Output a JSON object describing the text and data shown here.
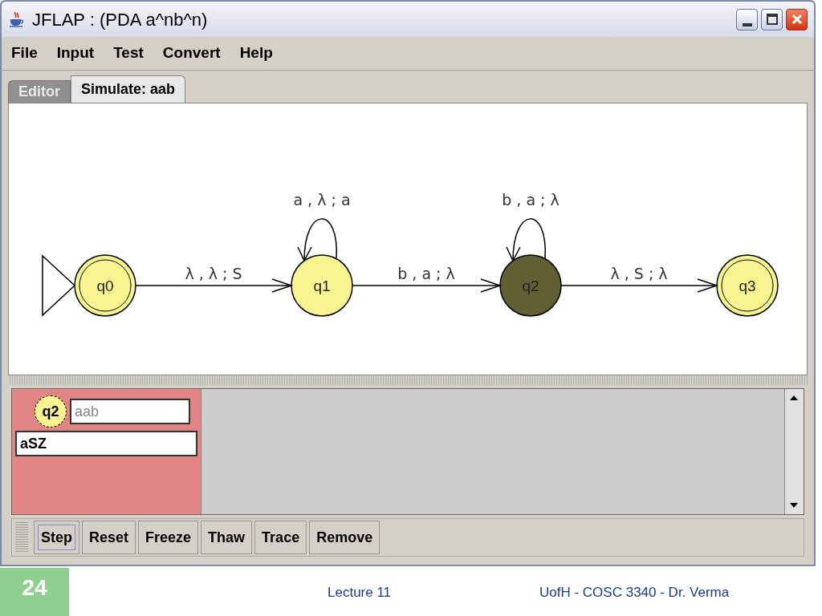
{
  "window": {
    "title": "JFLAP : (PDA a^nb^n)"
  },
  "menu": [
    "File",
    "Input",
    "Test",
    "Convert",
    "Help"
  ],
  "tabs": [
    {
      "label": "Editor",
      "selected": false
    },
    {
      "label": "Simulate: aab",
      "selected": true
    }
  ],
  "states": [
    {
      "name": "q0",
      "initial": true,
      "final": true,
      "active": false,
      "transition_to_next": "λ , λ ; S"
    },
    {
      "name": "q1",
      "initial": false,
      "final": false,
      "active": false,
      "loop": "a , λ ; a",
      "transition_to_next": "b , a ; λ"
    },
    {
      "name": "q2",
      "initial": false,
      "final": false,
      "active": true,
      "loop": "b , a ; λ",
      "transition_to_next": "λ , S ; λ"
    },
    {
      "name": "q3",
      "initial": false,
      "final": true,
      "active": false
    }
  ],
  "configuration": {
    "state": "q2",
    "input": "aab",
    "stack": "aSZ"
  },
  "buttons": [
    {
      "label": "Step",
      "selected": true
    },
    {
      "label": "Reset",
      "selected": false
    },
    {
      "label": "Freeze",
      "selected": false
    },
    {
      "label": "Thaw",
      "selected": false
    },
    {
      "label": "Trace",
      "selected": false
    },
    {
      "label": "Remove",
      "selected": false
    }
  ],
  "footer": {
    "slide_number": "24",
    "lecture": "Lecture 11",
    "course": "UofH - COSC 3340 - Dr. Verma"
  }
}
